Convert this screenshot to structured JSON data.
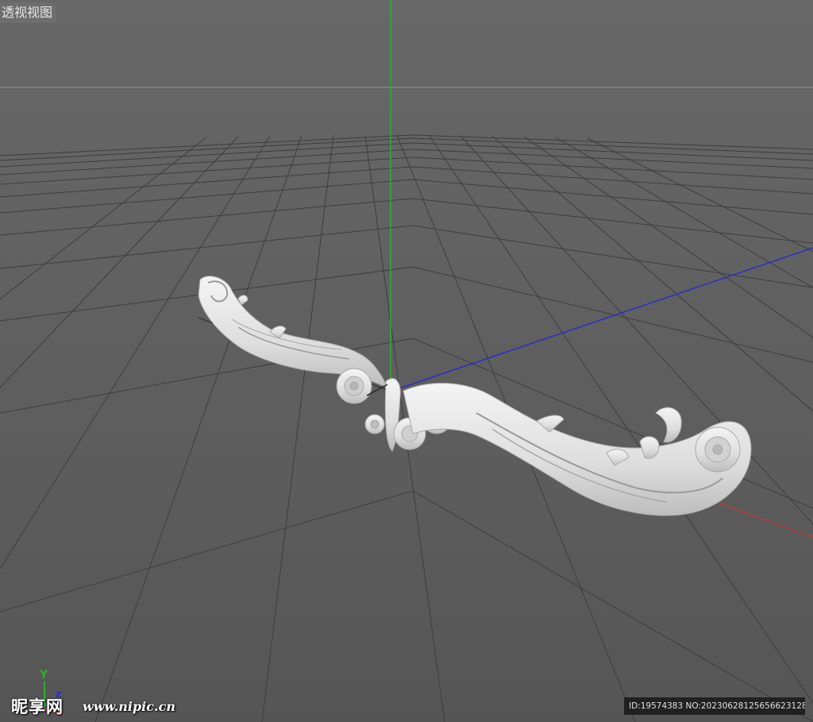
{
  "viewport": {
    "view_name": "透视视图",
    "background_color": "#5f5f5f",
    "grid_color": "#3a3a3a",
    "horizon_color": "#8a8a8a"
  },
  "axes": {
    "x_color": "#c23b3b",
    "y_color": "#2fb02f",
    "z_color": "#2b2bc8"
  },
  "axis_widget": {
    "y_label": "Y",
    "z_label": "Z"
  },
  "model": {
    "icon": "carved-scroll-ornament",
    "color": "#e6e6e6"
  },
  "watermark": {
    "logo_text": "昵享网",
    "site_text": "www.nipic.cn",
    "id_text": "ID:19574383 NO:20230628125656623128"
  }
}
